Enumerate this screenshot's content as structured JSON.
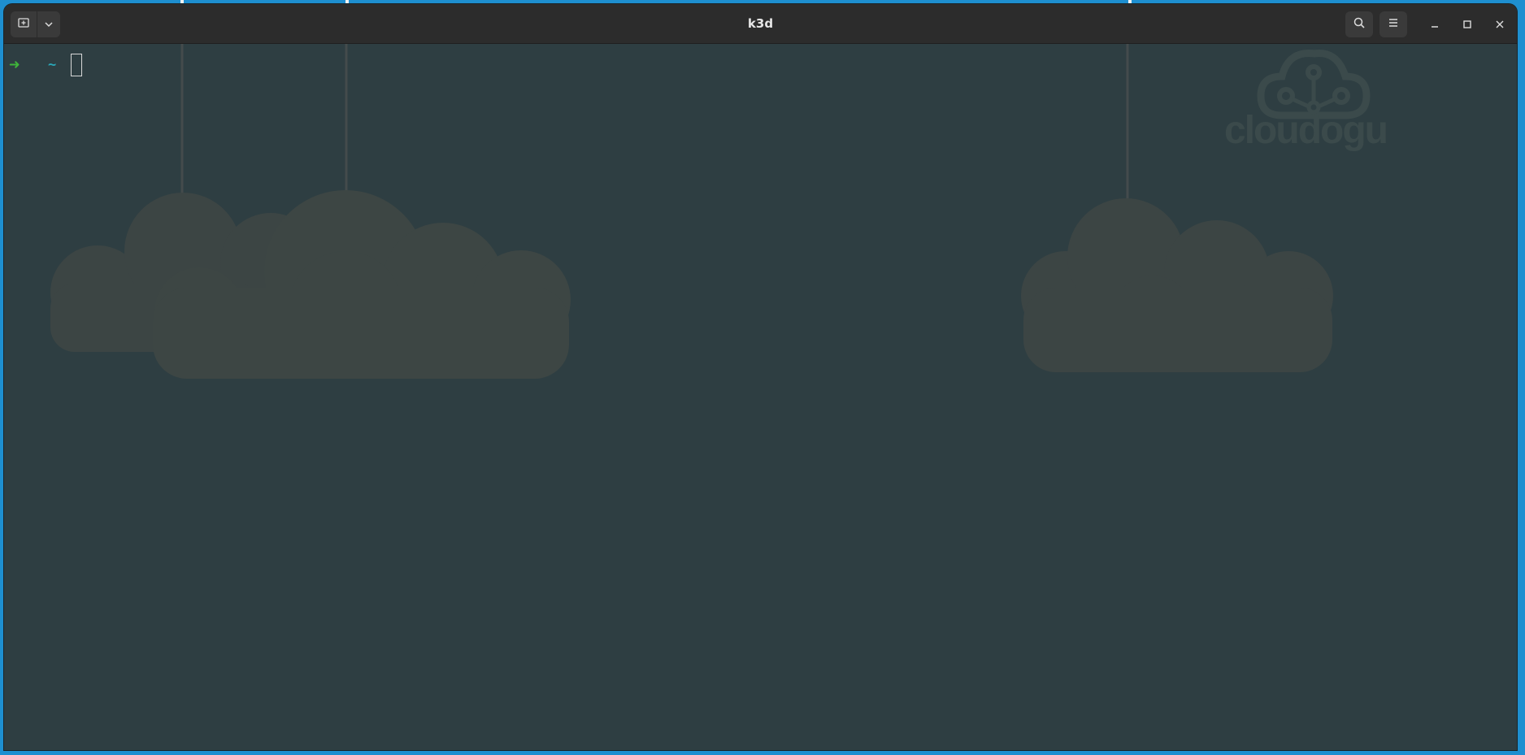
{
  "window": {
    "title": "k3d"
  },
  "toolbar": {
    "new_tab_icon": "new-tab-icon",
    "tab_menu_icon": "chevron-down-icon",
    "search_icon": "search-icon",
    "menu_icon": "hamburger-menu-icon",
    "minimize_icon": "minimize-icon",
    "maximize_icon": "maximize-icon",
    "close_icon": "close-icon"
  },
  "terminal": {
    "prompt_symbol": "➜",
    "directory": "~",
    "input_value": ""
  },
  "wallpaper": {
    "logo_text": "cloudogu"
  },
  "colors": {
    "desktop": "#1e8fd0",
    "terminal_bg": "#2e3e42",
    "titlebar": "#2c2c2c",
    "prompt_arrow": "#3fb43a",
    "prompt_dir": "#2aa7b8",
    "cloud": "#3c4544"
  }
}
